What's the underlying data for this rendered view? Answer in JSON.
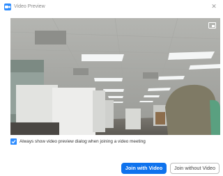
{
  "window": {
    "title": "Video Preview",
    "close_glyph": "✕"
  },
  "video": {
    "pip_icon": "picture-in-picture-icon"
  },
  "options": {
    "always_show_preview_label": "Always show video preview dialog when joining a video meeting",
    "always_show_preview_checked": true
  },
  "buttons": {
    "join_with_video": "Join with Video",
    "join_without_video": "Join without Video"
  },
  "colors": {
    "accent": "#0e72ed",
    "checkbox": "#2d8cff"
  }
}
